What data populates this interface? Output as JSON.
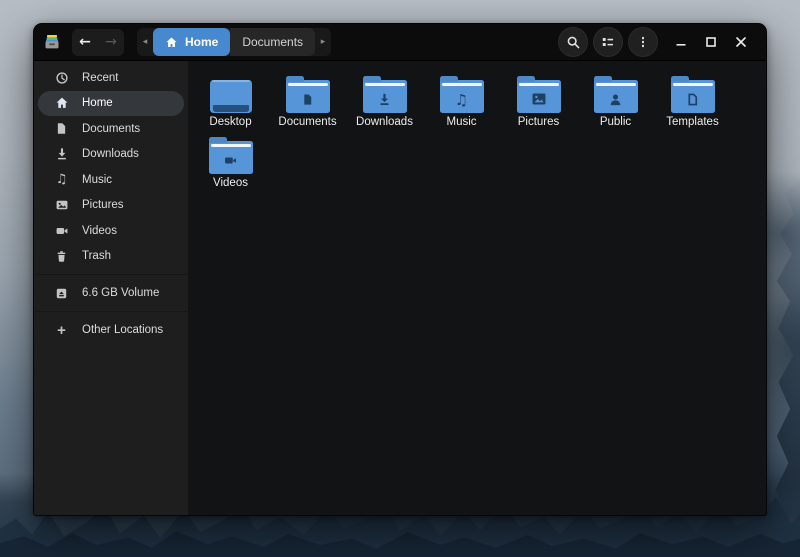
{
  "app": {
    "name": "Files",
    "type": "file-manager-window"
  },
  "header": {
    "nav": {
      "back": "←",
      "forward": "→"
    },
    "pager": {
      "prev": "◂",
      "next": "▸"
    },
    "path": [
      {
        "label": "Home",
        "active": true,
        "icon": "home-icon"
      },
      {
        "label": "Documents",
        "active": false
      }
    ],
    "buttons": [
      {
        "icon": "search-icon"
      },
      {
        "icon": "list-view-icon"
      },
      {
        "icon": "menu-ellipsis-icon"
      }
    ],
    "window_controls": [
      {
        "icon": "minimize-icon"
      },
      {
        "icon": "maximize-icon"
      },
      {
        "icon": "close-icon"
      }
    ]
  },
  "sidebar": {
    "items": [
      {
        "label": "Recent",
        "icon": "clock-icon",
        "selected": false
      },
      {
        "label": "Home",
        "icon": "home-icon",
        "selected": true
      },
      {
        "label": "Documents",
        "icon": "document-icon",
        "selected": false
      },
      {
        "label": "Downloads",
        "icon": "download-icon",
        "selected": false
      },
      {
        "label": "Music",
        "icon": "music-note-icon",
        "selected": false
      },
      {
        "label": "Pictures",
        "icon": "image-icon",
        "selected": false
      },
      {
        "label": "Videos",
        "icon": "video-camera-icon",
        "selected": false
      },
      {
        "label": "Trash",
        "icon": "trash-icon",
        "selected": false
      }
    ],
    "volume": {
      "label": "6.6 GB Volume",
      "icon": "drive-icon"
    },
    "other_locations": {
      "label": "Other Locations",
      "icon": "plus-icon"
    }
  },
  "files": {
    "items": [
      {
        "name": "Desktop",
        "icon": "desktop-icon"
      },
      {
        "name": "Documents",
        "icon": "folder-documents-icon"
      },
      {
        "name": "Downloads",
        "icon": "folder-downloads-icon"
      },
      {
        "name": "Music",
        "icon": "folder-music-icon"
      },
      {
        "name": "Pictures",
        "icon": "folder-pictures-icon"
      },
      {
        "name": "Public",
        "icon": "folder-public-icon"
      },
      {
        "name": "Templates",
        "icon": "folder-templates-icon"
      },
      {
        "name": "Videos",
        "icon": "folder-videos-icon"
      }
    ],
    "music_emblem_glyph": "♫",
    "sidebar_music_glyph": "♫"
  },
  "colors": {
    "accent_blue": "#4789cf",
    "folder_blue": "#5695d8",
    "emblem_navy": "#1d4063",
    "headerbar": "#0c0c0c",
    "sidebar_bg": "#1e1e1e",
    "content_bg": "#121315",
    "selected_row": "#34383d"
  }
}
